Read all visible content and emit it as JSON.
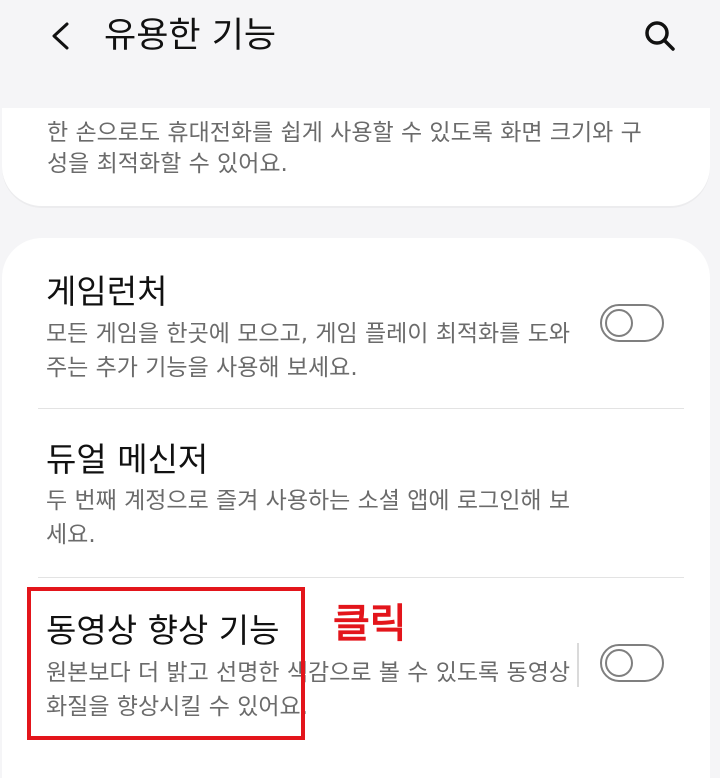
{
  "header": {
    "title": "유용한 기능"
  },
  "intro": {
    "description": "한 손으로도 휴대전화를 쉽게 사용할 수 있도록 화면 크기와 구성을 최적화할 수 있어요."
  },
  "settings": [
    {
      "title": "게임런처",
      "description": "모든 게임을 한곳에 모으고, 게임 플레이 최적화를 도와주는 추가 기능을 사용해 보세요.",
      "toggle_on": false
    },
    {
      "title": "듀얼 메신저",
      "description": "두 번째 계정으로 즐겨 사용하는 소셜 앱에 로그인해 보세요."
    },
    {
      "title": "동영상 향상 기능",
      "description": "원본보다 더 밝고 선명한 색감으로 볼 수 있도록 동영상 화질을 향상시킬 수 있어요.",
      "toggle_on": false
    }
  ],
  "annotation": {
    "label": "클릭",
    "color": "#e3151b"
  },
  "icons": {
    "back": "chevron-left-icon",
    "search": "search-icon"
  }
}
